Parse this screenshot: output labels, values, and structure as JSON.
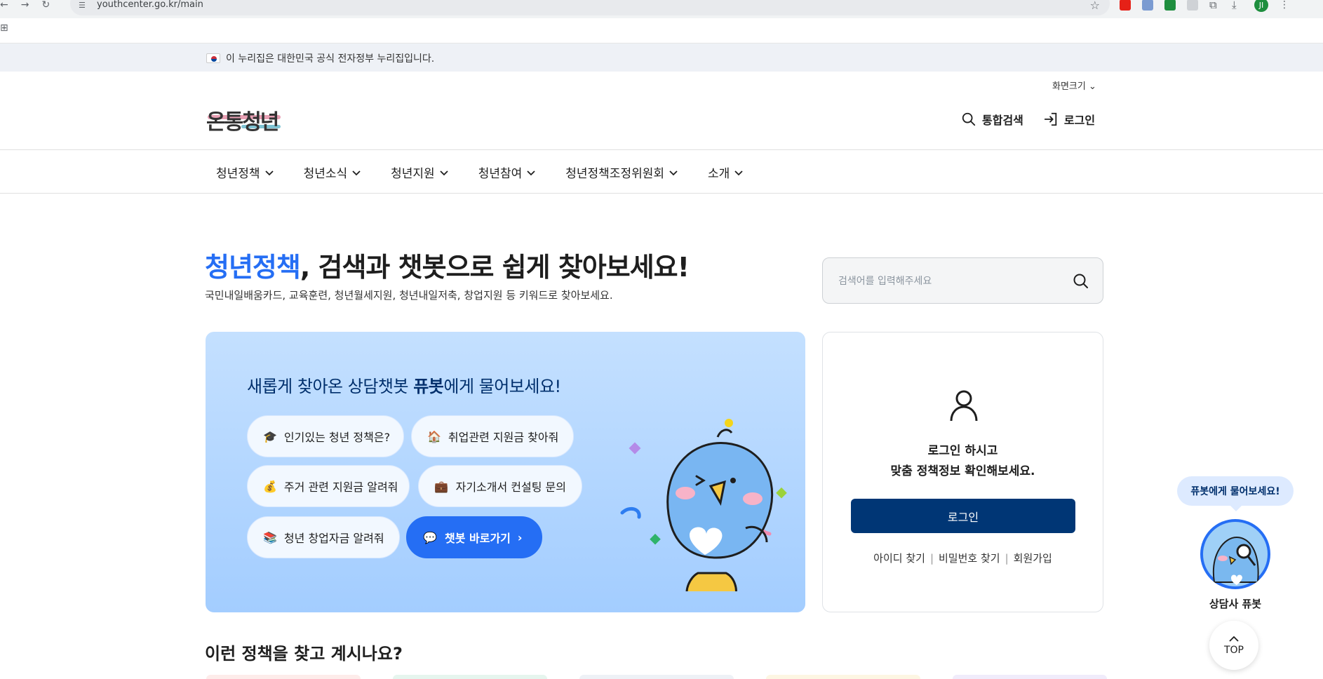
{
  "browser": {
    "url": "youthcenter.go.kr/main",
    "avatar_initial": "JI"
  },
  "gov_banner": {
    "text": "이 누리집은 대한민국 공식 전자정부 누리집입니다."
  },
  "header": {
    "logo_text": "온통청년",
    "screen_size_label": "화면크기 ⌄",
    "search_label": "통합검색",
    "login_label": "로그인"
  },
  "nav": {
    "items": [
      {
        "label": "청년정책"
      },
      {
        "label": "청년소식"
      },
      {
        "label": "청년지원"
      },
      {
        "label": "청년참여"
      },
      {
        "label": "청년정책조정위원회"
      },
      {
        "label": "소개"
      }
    ]
  },
  "hero": {
    "title_accent": "청년정책",
    "title_rest": ", 검색과 챗봇으로 쉽게 찾아보세요!",
    "subtitle": "국민내일배움카드, 교육훈련, 청년월세지원, 청년내일저축, 창업지원 등 키워드로 찾아보세요.",
    "search_placeholder": "검색어를 입력해주세요"
  },
  "chatbot": {
    "title_pre": "새롭게 찾아온 상담챗봇 ",
    "title_bold": "퓨봇",
    "title_post": "에게 물어보세요!",
    "chips": [
      {
        "label": "인기있는 청년 정책은?",
        "icon": "graduate-icon"
      },
      {
        "label": "취업관련 지원금 찾아줘",
        "icon": "house-icon"
      },
      {
        "label": "주거 관련 지원금 알려줘",
        "icon": "money-bag-icon"
      },
      {
        "label": "자기소개서 컨설팅 문의",
        "icon": "briefcase-icon"
      },
      {
        "label": "청년 창업자금 알려줘",
        "icon": "books-icon"
      },
      {
        "label": "챗봇 바로가기",
        "icon": "chat-icon"
      }
    ]
  },
  "login_card": {
    "line1": "로그인 하시고",
    "line2": "맞춤 정책정보 확인해보세요.",
    "button": "로그인",
    "links": [
      "아이디 찾기",
      "비밀번호 찾기",
      "회원가입"
    ]
  },
  "section": {
    "title": "이런 정책을 찾고 계시나요?"
  },
  "floating": {
    "bubble": "퓨봇에게 물어보세요!",
    "label": "상담사 퓨봇",
    "top": "TOP"
  },
  "colors": {
    "accent": "#256ef4",
    "navy": "#003675",
    "chat_bg": "#a3cdff"
  }
}
